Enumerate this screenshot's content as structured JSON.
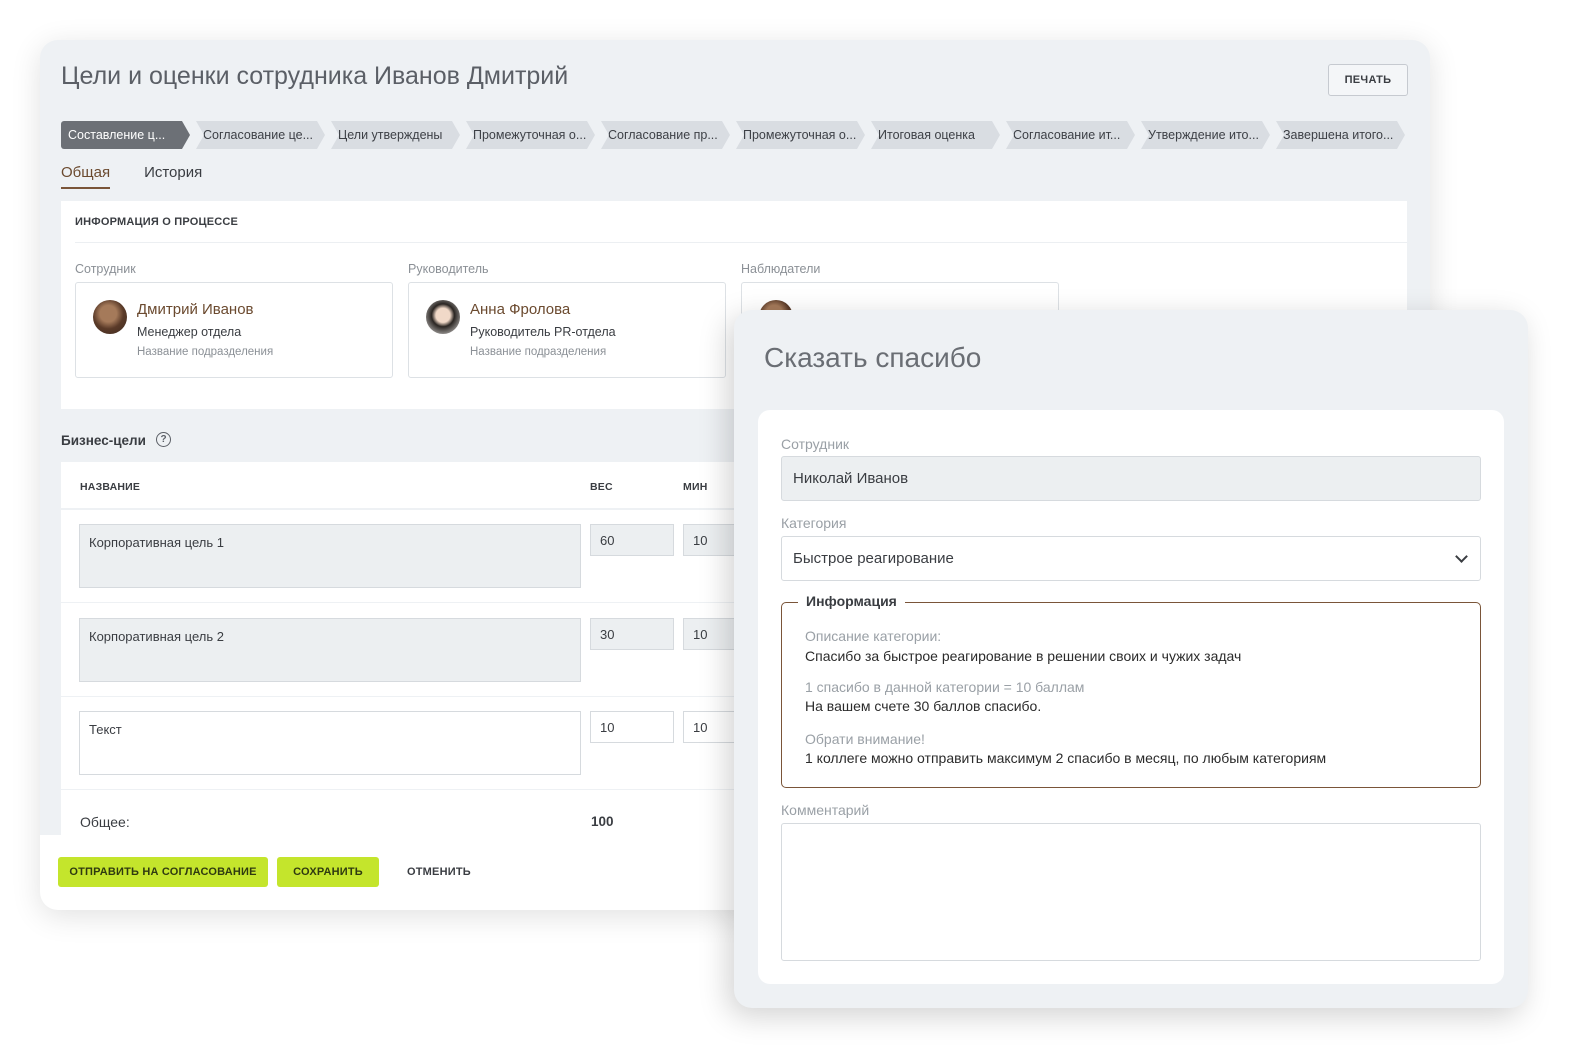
{
  "page": {
    "title": "Цели и оценки сотрудника Иванов Дмитрий",
    "print_label": "ПЕЧАТЬ"
  },
  "stages": [
    {
      "label": "Составление ц...",
      "active": true
    },
    {
      "label": "Согласование це...",
      "active": false
    },
    {
      "label": "Цели утверждены",
      "active": false
    },
    {
      "label": "Промежуточная о...",
      "active": false
    },
    {
      "label": "Согласование пр...",
      "active": false
    },
    {
      "label": "Промежуточная о...",
      "active": false
    },
    {
      "label": "Итоговая оценка",
      "active": false
    },
    {
      "label": "Согласование ит...",
      "active": false
    },
    {
      "label": "Утверждение ито...",
      "active": false
    },
    {
      "label": "Завершена итого...",
      "active": false
    }
  ],
  "tabs": [
    {
      "label": "Общая",
      "active": true
    },
    {
      "label": "История",
      "active": false
    }
  ],
  "process_info": {
    "title": "ИНФОРМАЦИЯ О ПРОЦЕССЕ",
    "employee": {
      "label": "Сотрудник",
      "name": "Дмитрий Иванов",
      "role": "Менеджер отдела",
      "dept": "Название подразделения"
    },
    "manager": {
      "label": "Руководитель",
      "name": "Анна Фролова",
      "role": "Руководитель PR-отдела",
      "dept": "Название подразделения"
    },
    "observers": {
      "label": "Наблюдатели"
    }
  },
  "business_goals": {
    "title": "Бизнес-цели",
    "help_icon": "?",
    "columns": {
      "name": "НАЗВАНИЕ",
      "weight": "ВЕС",
      "min": "МИН"
    },
    "rows": [
      {
        "name": "Корпоративная цель 1",
        "weight": "60",
        "min": "10"
      },
      {
        "name": "Корпоративная цель 2",
        "weight": "30",
        "min": "10"
      },
      {
        "name": "Текст",
        "weight": "10",
        "min": "10"
      }
    ],
    "total_label": "Общее:",
    "total_value": "100"
  },
  "footer": {
    "send_label": "ОТПРАВИТЬ НА СОГЛАСОВАНИЕ",
    "save_label": "СОХРАНИТЬ",
    "cancel_label": "ОТМЕНИТЬ"
  },
  "modal": {
    "title": "Сказать спасибо",
    "employee_label": "Сотрудник",
    "employee_value": "Николай Иванов",
    "category_label": "Категория",
    "category_value": "Быстрое реагирование",
    "info": {
      "legend": "Информация",
      "desc_label": "Описание категории:",
      "desc_text": "Спасибо за быстрое реагирование в решении своих и чужих задач",
      "rate_label": "1 спасибо в данной категории = 10 баллам",
      "balance_text": "На вашем счете 30 баллов спасибо.",
      "note_label": "Обрати внимание!",
      "note_text": "1 коллеге можно отправить максимум 2 спасибо в месяц, по любым категориям"
    },
    "comment_label": "Комментарий"
  },
  "colors": {
    "accent_brown": "#7a5539",
    "button_green": "#c4e52c",
    "active_stage": "#6c7076"
  }
}
